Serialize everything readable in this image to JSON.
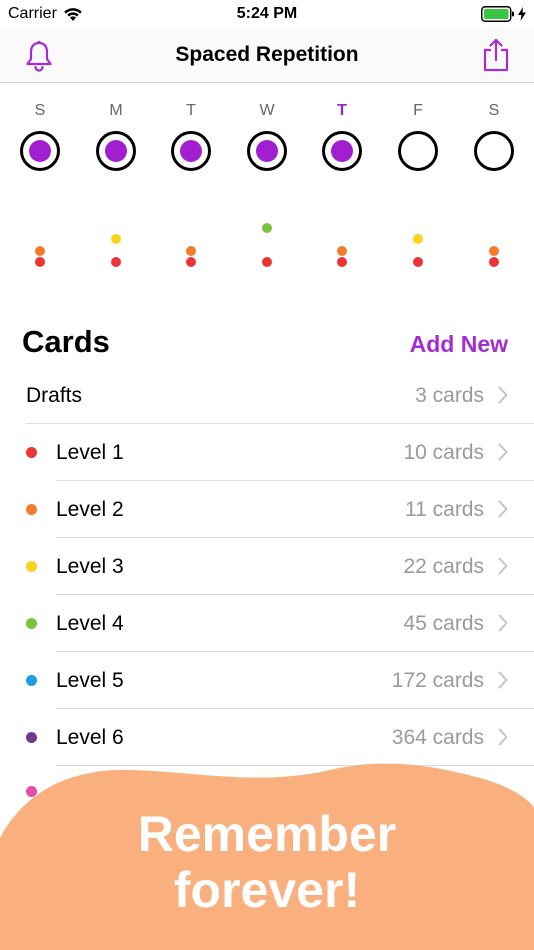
{
  "status_bar": {
    "carrier": "Carrier",
    "time": "5:24 PM",
    "wifi_icon": "wifi-icon",
    "battery_icon": "battery-full-icon",
    "charging_icon": "bolt-icon"
  },
  "nav": {
    "title": "Spaced Repetition",
    "left_icon": "bell-icon",
    "right_icon": "share-icon",
    "accent": "#a32dd2"
  },
  "week": {
    "days": [
      {
        "letter": "S",
        "filled": true,
        "today": false
      },
      {
        "letter": "M",
        "filled": true,
        "today": false
      },
      {
        "letter": "T",
        "filled": true,
        "today": false
      },
      {
        "letter": "W",
        "filled": true,
        "today": false
      },
      {
        "letter": "T",
        "filled": true,
        "today": true
      },
      {
        "letter": "F",
        "filled": false,
        "today": false
      },
      {
        "letter": "S",
        "filled": false,
        "today": false
      }
    ],
    "level_dots": [
      [
        "orange",
        "red"
      ],
      [
        "yellow",
        "red"
      ],
      [
        "orange",
        "red"
      ],
      [
        "green",
        "red"
      ],
      [
        "orange",
        "red"
      ],
      [
        "yellow",
        "red"
      ],
      [
        "orange",
        "red"
      ]
    ]
  },
  "level_colors": {
    "red": "#ec3434",
    "orange": "#f37b2b",
    "yellow": "#f8d21c",
    "green": "#7bc43a",
    "blue": "#1d9de0",
    "purple": "#6e3a8f",
    "pink": "#e94aa5"
  },
  "cards": {
    "title": "Cards",
    "add_new": "Add New",
    "rows": [
      {
        "label": "Drafts",
        "count": "3 cards",
        "dot": null
      },
      {
        "label": "Level 1",
        "count": "10 cards",
        "dot": "red"
      },
      {
        "label": "Level 2",
        "count": "11 cards",
        "dot": "orange"
      },
      {
        "label": "Level 3",
        "count": "22 cards",
        "dot": "yellow"
      },
      {
        "label": "Level 4",
        "count": "45 cards",
        "dot": "green"
      },
      {
        "label": "Level 5",
        "count": "172 cards",
        "dot": "blue"
      },
      {
        "label": "Level 6",
        "count": "364 cards",
        "dot": "purple"
      }
    ]
  },
  "promo": {
    "line1": "Remember",
    "line2": "forever!",
    "blob_color": "#f9b07e"
  }
}
